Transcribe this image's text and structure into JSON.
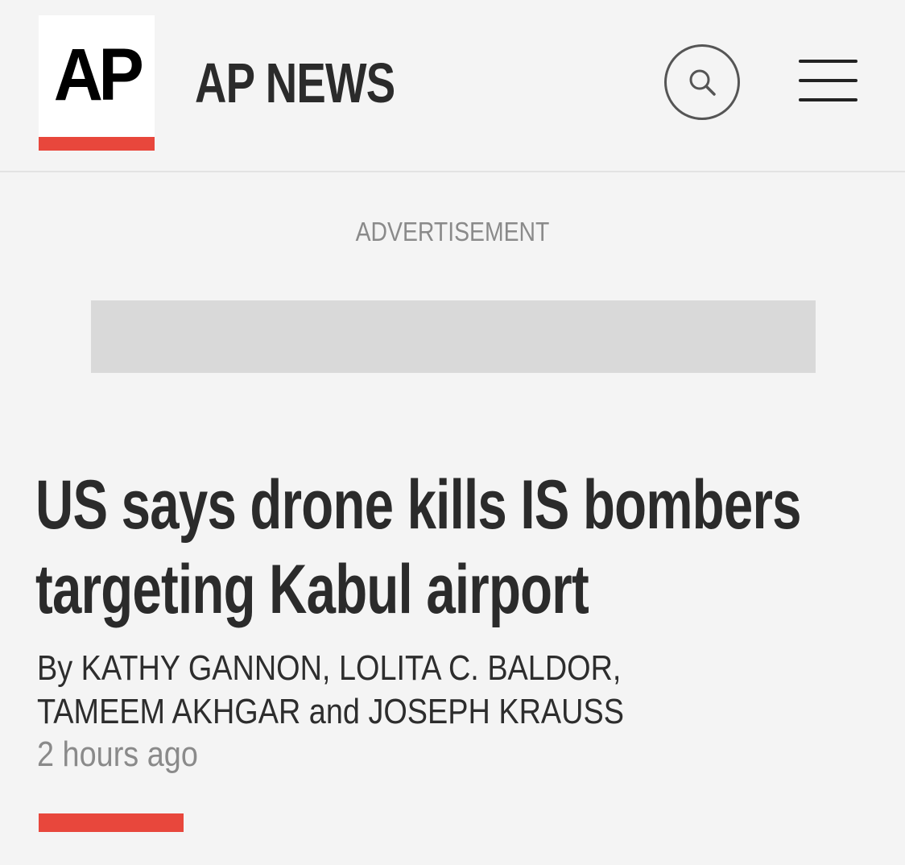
{
  "header": {
    "logo_text": "AP",
    "site_name": "AP NEWS",
    "icons": {
      "search": "search-icon",
      "menu": "hamburger-menu-icon"
    }
  },
  "advertisement": {
    "label": "ADVERTISEMENT"
  },
  "article": {
    "headline_line1": "US says drone kills IS bombers",
    "headline_line2": "targeting Kabul airport",
    "byline_line1": "By KATHY GANNON, LOLITA C. BALDOR,",
    "byline_line2": "TAMEEM AKHGAR and JOSEPH KRAUSS",
    "timestamp": "2 hours ago"
  },
  "colors": {
    "accent": "#e8473c",
    "background": "#f4f4f4",
    "ad_placeholder": "#d9d9d9",
    "muted_text": "#8a8a8a"
  }
}
